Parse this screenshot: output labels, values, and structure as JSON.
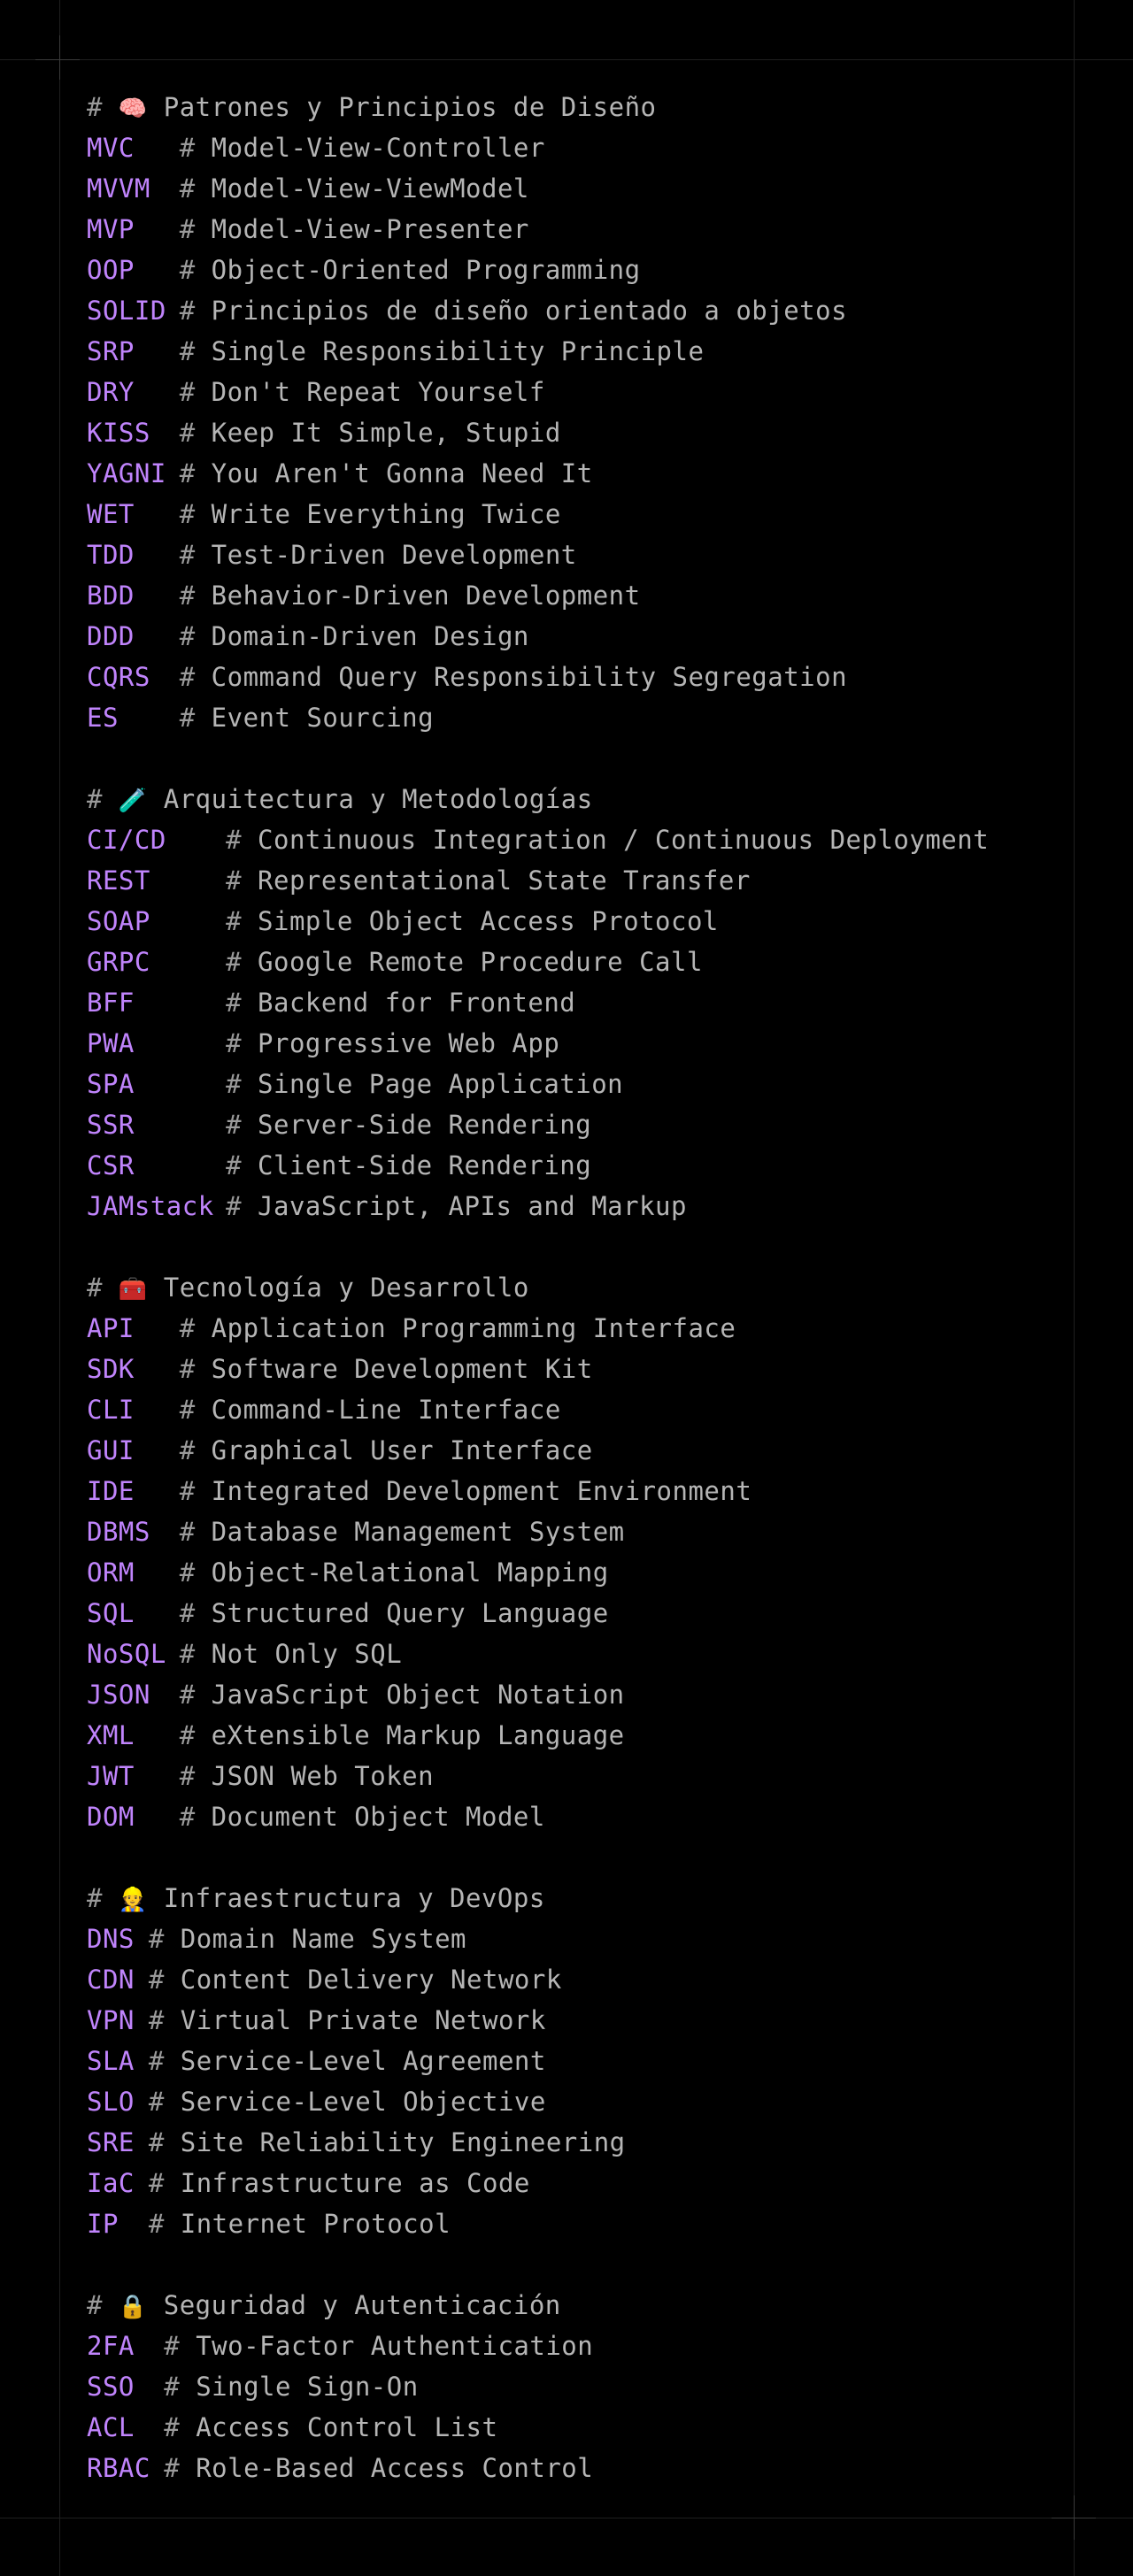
{
  "sections": [
    {
      "title": "Patrones y Principios de Diseño",
      "emoji": "🧠",
      "icon": "brain-icon",
      "items": [
        {
          "abbr": "MVC",
          "desc": "Model-View-Controller"
        },
        {
          "abbr": "MVVM",
          "desc": "Model-View-ViewModel"
        },
        {
          "abbr": "MVP",
          "desc": "Model-View-Presenter"
        },
        {
          "abbr": "OOP",
          "desc": "Object-Oriented Programming"
        },
        {
          "abbr": "SOLID",
          "desc": "Principios de diseño orientado a objetos"
        },
        {
          "abbr": "SRP",
          "desc": "Single Responsibility Principle"
        },
        {
          "abbr": "DRY",
          "desc": "Don't Repeat Yourself"
        },
        {
          "abbr": "KISS",
          "desc": "Keep It Simple, Stupid"
        },
        {
          "abbr": "YAGNI",
          "desc": "You Aren't Gonna Need It"
        },
        {
          "abbr": "WET",
          "desc": "Write Everything Twice"
        },
        {
          "abbr": "TDD",
          "desc": "Test-Driven Development"
        },
        {
          "abbr": "BDD",
          "desc": "Behavior-Driven Development"
        },
        {
          "abbr": "DDD",
          "desc": "Domain-Driven Design"
        },
        {
          "abbr": "CQRS",
          "desc": "Command Query Responsibility Segregation"
        },
        {
          "abbr": "ES",
          "desc": "Event Sourcing"
        }
      ]
    },
    {
      "title": "Arquitectura y Metodologías",
      "emoji": "🧪",
      "icon": "test-tube-icon",
      "items": [
        {
          "abbr": "CI/CD",
          "desc": "Continuous Integration / Continuous Deployment"
        },
        {
          "abbr": "REST",
          "desc": "Representational State Transfer"
        },
        {
          "abbr": "SOAP",
          "desc": "Simple Object Access Protocol"
        },
        {
          "abbr": "GRPC",
          "desc": "Google Remote Procedure Call"
        },
        {
          "abbr": "BFF",
          "desc": "Backend for Frontend"
        },
        {
          "abbr": "PWA",
          "desc": "Progressive Web App"
        },
        {
          "abbr": "SPA",
          "desc": "Single Page Application"
        },
        {
          "abbr": "SSR",
          "desc": "Server-Side Rendering"
        },
        {
          "abbr": "CSR",
          "desc": "Client-Side Rendering"
        },
        {
          "abbr": "JAMstack",
          "desc": "JavaScript, APIs and Markup"
        }
      ]
    },
    {
      "title": "Tecnología y Desarrollo",
      "emoji": "🧰",
      "icon": "toolbox-icon",
      "items": [
        {
          "abbr": "API",
          "desc": "Application Programming Interface"
        },
        {
          "abbr": "SDK",
          "desc": "Software Development Kit"
        },
        {
          "abbr": "CLI",
          "desc": "Command-Line Interface"
        },
        {
          "abbr": "GUI",
          "desc": "Graphical User Interface"
        },
        {
          "abbr": "IDE",
          "desc": "Integrated Development Environment"
        },
        {
          "abbr": "DBMS",
          "desc": "Database Management System"
        },
        {
          "abbr": "ORM",
          "desc": "Object-Relational Mapping"
        },
        {
          "abbr": "SQL",
          "desc": "Structured Query Language"
        },
        {
          "abbr": "NoSQL",
          "desc": "Not Only SQL"
        },
        {
          "abbr": "JSON",
          "desc": "JavaScript Object Notation"
        },
        {
          "abbr": "XML",
          "desc": "eXtensible Markup Language"
        },
        {
          "abbr": "JWT",
          "desc": "JSON Web Token"
        },
        {
          "abbr": "DOM",
          "desc": "Document Object Model"
        }
      ]
    },
    {
      "title": "Infraestructura y DevOps",
      "emoji": "👷",
      "icon": "construction-worker-icon",
      "items": [
        {
          "abbr": "DNS",
          "desc": "Domain Name System"
        },
        {
          "abbr": "CDN",
          "desc": "Content Delivery Network"
        },
        {
          "abbr": "VPN",
          "desc": "Virtual Private Network"
        },
        {
          "abbr": "SLA",
          "desc": "Service-Level Agreement"
        },
        {
          "abbr": "SLO",
          "desc": "Service-Level Objective"
        },
        {
          "abbr": "SRE",
          "desc": "Site Reliability Engineering"
        },
        {
          "abbr": "IaC",
          "desc": "Infrastructure as Code"
        },
        {
          "abbr": "IP",
          "desc": "Internet Protocol"
        }
      ]
    },
    {
      "title": "Seguridad y Autenticación",
      "emoji": "🔒",
      "icon": "lock-icon",
      "items": [
        {
          "abbr": "2FA",
          "desc": "Two-Factor Authentication"
        },
        {
          "abbr": "SSO",
          "desc": "Single Sign-On"
        },
        {
          "abbr": "ACL",
          "desc": "Access Control List"
        },
        {
          "abbr": "RBAC",
          "desc": "Role-Based Access Control"
        }
      ]
    }
  ],
  "colors": {
    "background": "#000000",
    "abbreviation": "#c084fc",
    "comment": "#b5b5b5"
  }
}
